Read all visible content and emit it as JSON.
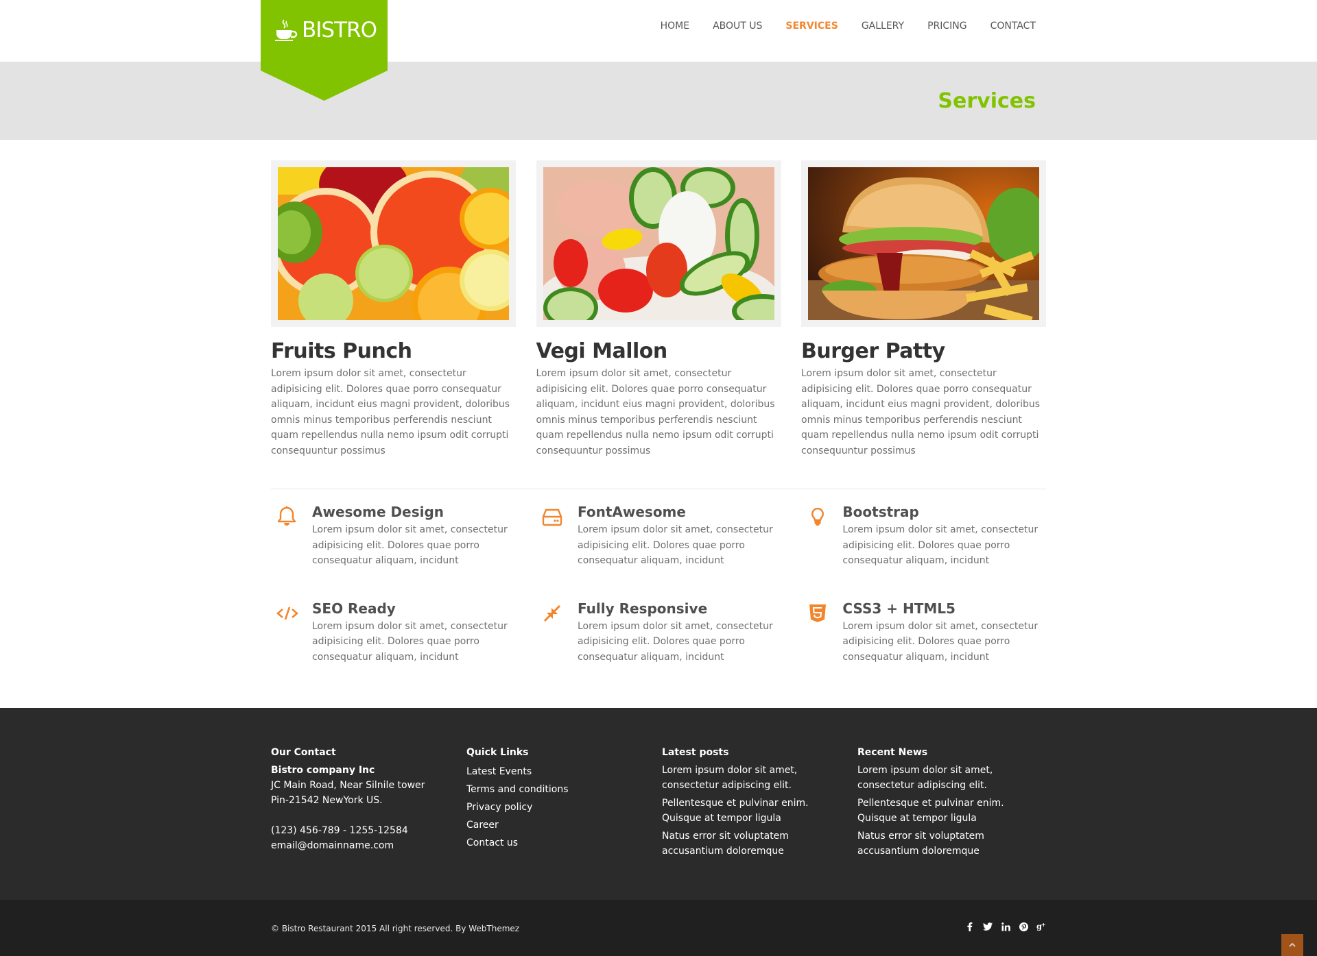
{
  "brand": {
    "name": "BISTRO",
    "logo_icon": "coffee-cup-icon",
    "color": "#81c300"
  },
  "nav": {
    "items": [
      {
        "label": "HOME",
        "active": false
      },
      {
        "label": "ABOUT US",
        "active": false
      },
      {
        "label": "SERVICES",
        "active": true
      },
      {
        "label": "GALLERY",
        "active": false
      },
      {
        "label": "PRICING",
        "active": false
      },
      {
        "label": "CONTACT",
        "active": false
      }
    ],
    "active_color": "#f2862d"
  },
  "page": {
    "title": "Services"
  },
  "cards": [
    {
      "title": "Fruits Punch",
      "image": "citrus-fruit-slices",
      "text": "Lorem ipsum dolor sit amet, consectetur adipisicing elit. Dolores quae porro consequatur aliquam, incidunt eius magni provident, doloribus omnis minus temporibus perferendis nesciunt quam repellendus nulla nemo ipsum odit corrupti consequuntur possimus"
    },
    {
      "title": "Vegi Mallon",
      "image": "vegetable-salad-with-egg",
      "text": "Lorem ipsum dolor sit amet, consectetur adipisicing elit. Dolores quae porro consequatur aliquam, incidunt eius magni provident, doloribus omnis minus temporibus perferendis nesciunt quam repellendus nulla nemo ipsum odit corrupti consequuntur possimus"
    },
    {
      "title": "Burger Patty",
      "image": "chicken-burger-with-fries",
      "text": "Lorem ipsum dolor sit amet, consectetur adipisicing elit. Dolores quae porro consequatur aliquam, incidunt eius magni provident, doloribus omnis minus temporibus perferendis nesciunt quam repellendus nulla nemo ipsum odit corrupti consequuntur possimus"
    }
  ],
  "features": [
    {
      "icon": "bell-icon",
      "title": "Awesome Design",
      "text": "Lorem ipsum dolor sit amet, consectetur adipisicing elit. Dolores quae porro consequatur aliquam, incidunt"
    },
    {
      "icon": "hdd-icon",
      "title": "FontAwesome",
      "text": "Lorem ipsum dolor sit amet, consectetur adipisicing elit. Dolores quae porro consequatur aliquam, incidunt"
    },
    {
      "icon": "lightbulb-icon",
      "title": "Bootstrap",
      "text": "Lorem ipsum dolor sit amet, consectetur adipisicing elit. Dolores quae porro consequatur aliquam, incidunt"
    },
    {
      "icon": "code-icon",
      "title": "SEO Ready",
      "text": "Lorem ipsum dolor sit amet, consectetur adipisicing elit. Dolores quae porro consequatur aliquam, incidunt"
    },
    {
      "icon": "compress-icon",
      "title": "Fully Responsive",
      "text": "Lorem ipsum dolor sit amet, consectetur adipisicing elit. Dolores quae porro consequatur aliquam, incidunt"
    },
    {
      "icon": "html5-icon",
      "title": "CSS3 + HTML5",
      "text": "Lorem ipsum dolor sit amet, consectetur adipisicing elit. Dolores quae porro consequatur aliquam, incidunt"
    }
  ],
  "footer": {
    "contact": {
      "title": "Our Contact",
      "company": "Bistro company Inc",
      "address_line1": "JC Main Road, Near Silnile tower",
      "address_line2": "Pin-21542 NewYork US.",
      "phone": "(123) 456-789 - 1255-12584",
      "email": "email@domainname.com"
    },
    "quick_links": {
      "title": "Quick Links",
      "items": [
        "Latest Events",
        "Terms and conditions",
        "Privacy policy",
        "Career",
        "Contact us"
      ]
    },
    "latest_posts": {
      "title": "Latest posts",
      "items": [
        "Lorem ipsum dolor sit amet, consectetur adipiscing elit.",
        "Pellentesque et pulvinar enim. Quisque at tempor ligula",
        "Natus error sit voluptatem accusantium doloremque"
      ]
    },
    "recent_news": {
      "title": "Recent News",
      "items": [
        "Lorem ipsum dolor sit amet, consectetur adipiscing elit.",
        "Pellentesque et pulvinar enim. Quisque at tempor ligula",
        "Natus error sit voluptatem accusantium doloremque"
      ]
    },
    "copyright": "© Bistro Restaurant 2015 All right reserved. By WebThemez",
    "social": [
      {
        "icon": "facebook-icon",
        "glyph": "f"
      },
      {
        "icon": "twitter-icon",
        "glyph": "t"
      },
      {
        "icon": "linkedin-icon",
        "glyph": "in"
      },
      {
        "icon": "pinterest-icon",
        "glyph": "p"
      },
      {
        "icon": "google-plus-icon",
        "glyph": "g+"
      }
    ],
    "scroll_top_icon": "chevron-up-icon",
    "scroll_top_color": "#a0541a"
  }
}
